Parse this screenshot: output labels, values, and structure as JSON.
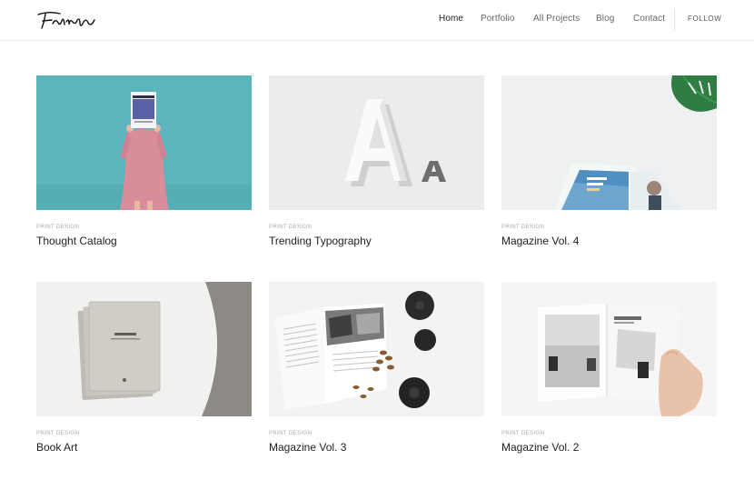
{
  "header": {
    "logo_text": "Folyo",
    "nav": [
      "Home",
      "Portfolio",
      "All Projects",
      "Blog",
      "Contact"
    ],
    "active": "Home",
    "follow": "FOLLOW"
  },
  "projects": [
    {
      "category": "PRINT DESIGN",
      "title": "Thought Catalog",
      "image": "woman-holding-magazine"
    },
    {
      "category": "PRINT DESIGN",
      "title": "Trending Typography",
      "image": "letter-a-sculptures"
    },
    {
      "category": "PRINT DESIGN",
      "title": "Magazine Vol. 4",
      "image": "magazine-with-plant"
    },
    {
      "category": "PRINT DESIGN",
      "title": "Book Art",
      "image": "stacked-notebooks"
    },
    {
      "category": "PRINT DESIGN",
      "title": "Magazine Vol. 3",
      "image": "open-magazine-teapot"
    },
    {
      "category": "PRINT DESIGN",
      "title": "Magazine Vol. 2",
      "image": "hand-holding-magazine"
    }
  ],
  "colors": {
    "accent": "#222222",
    "muted": "#a8a8a8"
  }
}
